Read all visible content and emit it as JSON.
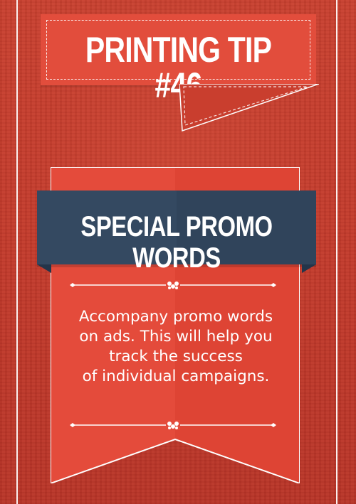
{
  "header": {
    "title": "PRINTING TIP #46"
  },
  "ribbon": {
    "title": "SPECIAL PROMO WORDS",
    "body_lines": [
      "Accompany promo words",
      "on ads. This will help you",
      "track the success",
      "of individual campaigns."
    ]
  },
  "colors": {
    "background": "#c43a2a",
    "banner_red": "#e24d3c",
    "title_bar_navy": "#344961",
    "text": "#ffffff"
  },
  "icons": [
    "flourish-ornament-icon",
    "diamond-icon"
  ]
}
